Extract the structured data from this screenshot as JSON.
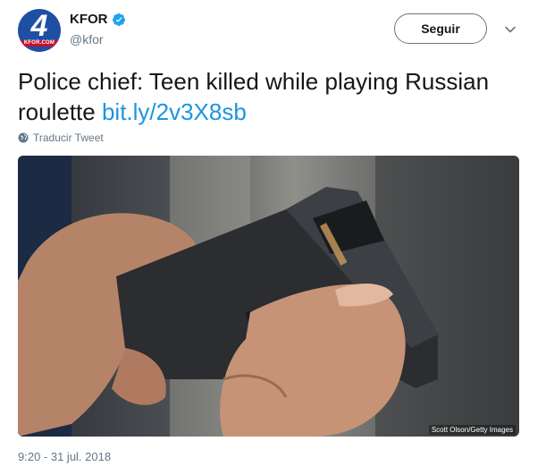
{
  "account": {
    "avatar_digit": "4",
    "avatar_callsign": "KFOR.COM",
    "display_name": "KFOR",
    "handle": "@kfor",
    "verified": true
  },
  "follow_button_label": "Seguir",
  "menu_icon": "chevron-down-icon",
  "tweet": {
    "text": "Police chief: Teen killed while playing Russian roulette ",
    "link": "bit.ly/2v3X8sb"
  },
  "translate_label": "Traducir Tweet",
  "media": {
    "description_icon": "photo",
    "credit": "Scott Olson/Getty Images"
  },
  "timestamp": "9:20 - 31 jul. 2018",
  "colors": {
    "link": "#1b95e0",
    "verified": "#1da1f2",
    "secondary_text": "#657786",
    "avatar_bg": "#1f4fa3"
  }
}
